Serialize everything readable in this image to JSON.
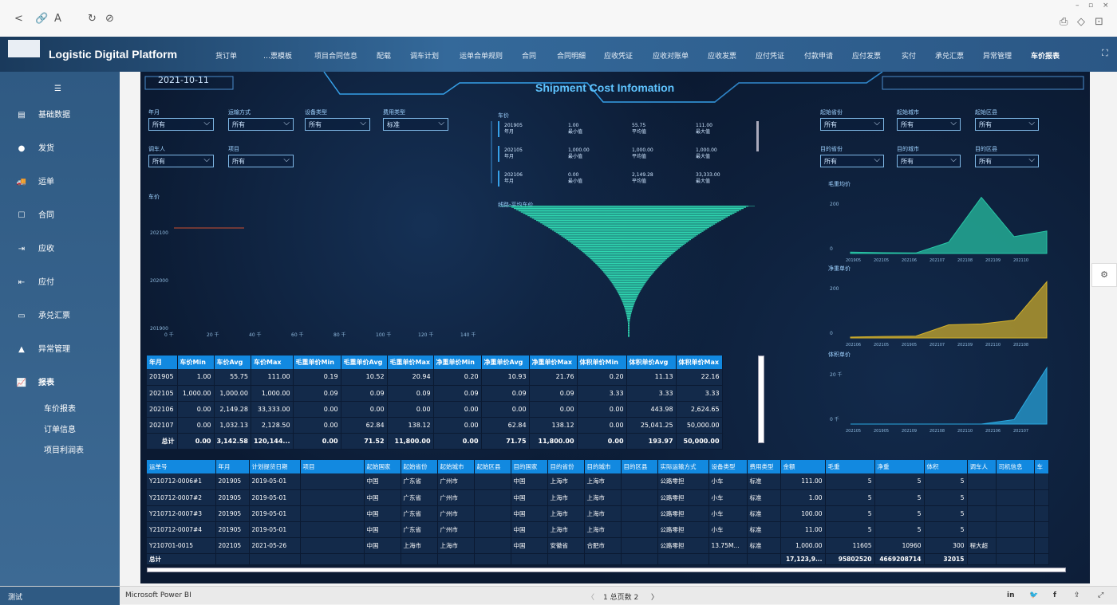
{
  "browser": {
    "back": "<",
    "link": "🔗",
    "read": "A",
    "refresh": "↻",
    "stop": "⊘",
    "min": "–",
    "restore": "▫",
    "close": "×",
    "share": "⎙",
    "ext1": "◇",
    "ext2": "⊡"
  },
  "header": {
    "app_title": "Logistic Digital Platform",
    "expand": "⛶",
    "nav": [
      "货订单",
      "…票模板",
      "项目合同信息",
      "配载",
      "调车计划",
      "运单合单规则",
      "合同",
      "合同明细",
      "应收凭证",
      "应收对账单",
      "应收发票",
      "应付凭证",
      "付款申请",
      "应付发票",
      "实付",
      "承兑汇票",
      "异常管理",
      "车价报表"
    ]
  },
  "sidebar": {
    "collapse": "☰",
    "items": [
      {
        "icon": "▤",
        "label": "基础数据"
      },
      {
        "icon": "●",
        "label": "发货"
      },
      {
        "icon": "🚚",
        "label": "运单"
      },
      {
        "icon": "☐",
        "label": "合同"
      },
      {
        "icon": "⇥",
        "label": "应收"
      },
      {
        "icon": "⇤",
        "label": "应付"
      },
      {
        "icon": "▭",
        "label": "承兑汇票"
      },
      {
        "icon": "▲",
        "label": "异常管理"
      },
      {
        "icon": "📈",
        "label": "报表"
      }
    ],
    "subs": [
      "车价报表",
      "订单信息",
      "项目利润表"
    ],
    "user": "测试"
  },
  "report": {
    "date": "2021-10-11",
    "title": "Shipment Cost Infomation",
    "filters_left": [
      {
        "label": "年月",
        "value": "所有"
      },
      {
        "label": "运输方式",
        "value": "所有"
      },
      {
        "label": "设备类型",
        "value": "所有"
      },
      {
        "label": "费用类型",
        "value": "标准"
      },
      {
        "label": "调车人",
        "value": "所有"
      },
      {
        "label": "项目",
        "value": "所有"
      }
    ],
    "filters_right": [
      {
        "label": "起始省份",
        "value": "所有"
      },
      {
        "label": "起始城市",
        "value": "所有"
      },
      {
        "label": "起始区县",
        "value": "所有"
      },
      {
        "label": "目的省份",
        "value": "所有"
      },
      {
        "label": "目的城市",
        "value": "所有"
      },
      {
        "label": "目的区县",
        "value": "所有"
      }
    ],
    "kpi_title": "车价",
    "kpi_rows": [
      {
        "ym": "201905",
        "ym_l": "年月",
        "min": "1.00",
        "min_l": "最小值",
        "avg": "55.75",
        "avg_l": "平均值",
        "max": "111.00",
        "max_l": "最大值"
      },
      {
        "ym": "202105",
        "ym_l": "年月",
        "min": "1,000.00",
        "min_l": "最小值",
        "avg": "1,000.00",
        "avg_l": "平均值",
        "max": "1,000.00",
        "max_l": "最大值"
      },
      {
        "ym": "202106",
        "ym_l": "年月",
        "min": "0.00",
        "min_l": "最小值",
        "avg": "2,149.28",
        "avg_l": "平均值",
        "max": "33,333.00",
        "max_l": "最大值"
      }
    ],
    "line_chart": {
      "title": "车价",
      "yticks": [
        "202100",
        "202000",
        "201900"
      ],
      "xticks": [
        "0 千",
        "20 千",
        "40 千",
        "60 千",
        "80 千",
        "100 千",
        "120 千",
        "140 千"
      ]
    },
    "funnel_title": "线路-平均车价",
    "area_charts": [
      {
        "title": "毛重均价",
        "yticks": [
          "200",
          "0"
        ],
        "xticks": [
          "201905",
          "202105",
          "202106",
          "202107",
          "202108",
          "202109",
          "202110"
        ],
        "color": "#28c7a6",
        "values": [
          5,
          3,
          2,
          40,
          200,
          60,
          80
        ]
      },
      {
        "title": "净重单价",
        "yticks": [
          "200",
          "0"
        ],
        "xticks": [
          "202106",
          "202105",
          "201905",
          "202107",
          "202109",
          "202110",
          "202108"
        ],
        "color": "#d4b12a",
        "values": [
          5,
          8,
          10,
          70,
          75,
          95,
          300
        ]
      },
      {
        "title": "体积单价",
        "yticks": [
          "20 千",
          "0 千"
        ],
        "xticks": [
          "202105",
          "201905",
          "202109",
          "202108",
          "202110",
          "202106",
          "202107"
        ],
        "color": "#2aa8e0",
        "values": [
          0,
          0,
          0,
          0,
          0,
          2,
          25
        ]
      }
    ],
    "stats_table": {
      "headers": [
        "年月",
        "车价Min",
        "车价Avg",
        "车价Max",
        "毛重单价Min",
        "毛重单价Avg",
        "毛重单价Max",
        "净重单价Min",
        "净重单价Avg",
        "净重单价Max",
        "体积单价Min",
        "体积单价Avg",
        "体积单价Max"
      ],
      "rows": [
        [
          "201905",
          "1.00",
          "55.75",
          "111.00",
          "0.19",
          "10.52",
          "20.94",
          "0.20",
          "10.93",
          "21.76",
          "0.20",
          "11.13",
          "22.16"
        ],
        [
          "202105",
          "1,000.00",
          "1,000.00",
          "1,000.00",
          "0.09",
          "0.09",
          "0.09",
          "0.09",
          "0.09",
          "0.09",
          "3.33",
          "3.33",
          "3.33"
        ],
        [
          "202106",
          "0.00",
          "2,149.28",
          "33,333.00",
          "0.00",
          "0.00",
          "0.00",
          "0.00",
          "0.00",
          "0.00",
          "0.00",
          "443.98",
          "2,624.65"
        ],
        [
          "202107",
          "0.00",
          "1,032.13",
          "2,128.50",
          "0.00",
          "62.84",
          "138.12",
          "0.00",
          "62.84",
          "138.12",
          "0.00",
          "25,041.25",
          "50,000.00"
        ]
      ],
      "total": [
        "总计",
        "0.00",
        "3,142.58",
        "120,144...",
        "0.00",
        "71.52",
        "11,800.00",
        "0.00",
        "71.75",
        "11,800.00",
        "0.00",
        "193.97",
        "50,000.00"
      ]
    },
    "detail_table": {
      "headers": [
        "运单号",
        "年月",
        "计划提货日期",
        "项目",
        "起始国家",
        "起始省份",
        "起始城市",
        "起始区县",
        "目的国家",
        "目的省份",
        "目的城市",
        "目的区县",
        "实际运输方式",
        "设备类型",
        "费用类型",
        "金额",
        "毛重",
        "净重",
        "体积",
        "调车人",
        "司机信息",
        "车"
      ],
      "rows": [
        [
          "Y210712-0006#1",
          "201905",
          "2019-05-01",
          "",
          "中国",
          "广东省",
          "广州市",
          "",
          "中国",
          "上海市",
          "上海市",
          "",
          "公路零担",
          "小车",
          "标准",
          "111.00",
          "5",
          "5",
          "5",
          "",
          "",
          ""
        ],
        [
          "Y210712-0007#2",
          "201905",
          "2019-05-01",
          "",
          "中国",
          "广东省",
          "广州市",
          "",
          "中国",
          "上海市",
          "上海市",
          "",
          "公路零担",
          "小车",
          "标准",
          "1.00",
          "5",
          "5",
          "5",
          "",
          "",
          ""
        ],
        [
          "Y210712-0007#3",
          "201905",
          "2019-05-01",
          "",
          "中国",
          "广东省",
          "广州市",
          "",
          "中国",
          "上海市",
          "上海市",
          "",
          "公路零担",
          "小车",
          "标准",
          "100.00",
          "5",
          "5",
          "5",
          "",
          "",
          ""
        ],
        [
          "Y210712-0007#4",
          "201905",
          "2019-05-01",
          "",
          "中国",
          "广东省",
          "广州市",
          "",
          "中国",
          "上海市",
          "上海市",
          "",
          "公路零担",
          "小车",
          "标准",
          "11.00",
          "5",
          "5",
          "5",
          "",
          "",
          ""
        ],
        [
          "Y210701-0015",
          "202105",
          "2021-05-26",
          "",
          "中国",
          "上海市",
          "上海市",
          "",
          "中国",
          "安徽省",
          "合肥市",
          "",
          "公路零担",
          "13.75M...",
          "标准",
          "1,000.00",
          "11605",
          "10960",
          "300",
          "程大超",
          "",
          ""
        ]
      ],
      "total": [
        "总计",
        "",
        "",
        "",
        "",
        "",
        "",
        "",
        "",
        "",
        "",
        "",
        "",
        "",
        "",
        "17,123,9...",
        "95802520",
        "4669208714",
        "32015",
        "",
        "",
        ""
      ]
    }
  },
  "status": {
    "app": "Microsoft Power BI",
    "pager": "1 总页数 2",
    "prev": "〈",
    "next": "〉",
    "icons": [
      "in",
      "🐦",
      "f",
      "⇪",
      "⤢"
    ]
  }
}
